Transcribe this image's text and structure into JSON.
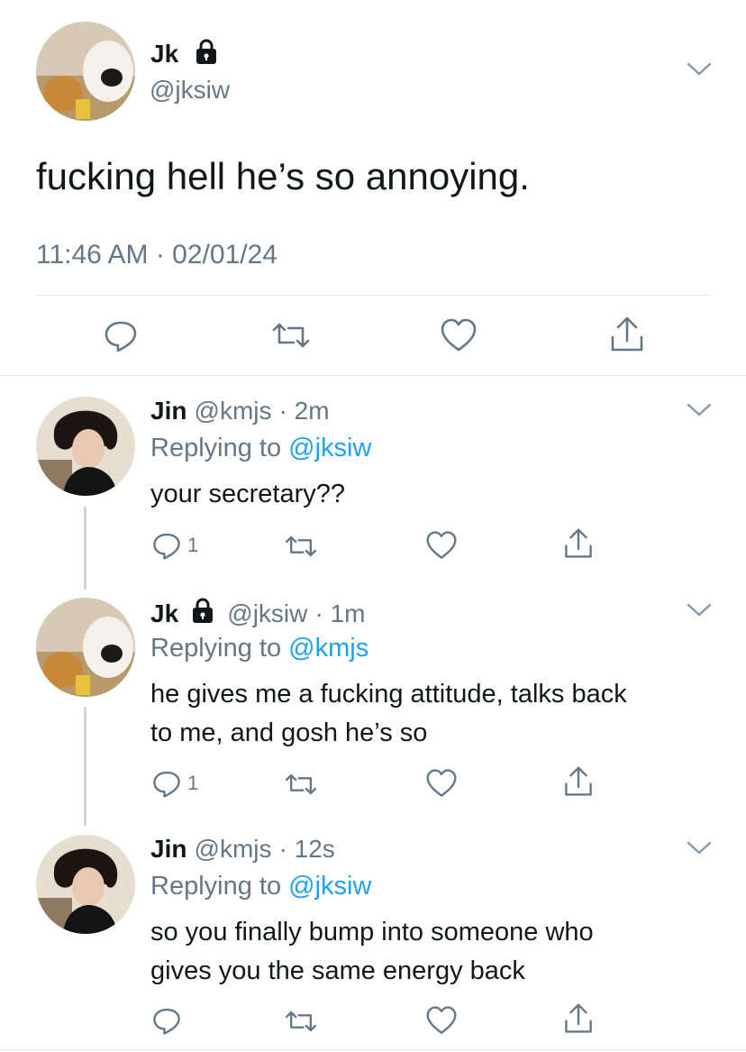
{
  "colors": {
    "link": "#1da1f2",
    "muted": "#657786",
    "text": "#14171a",
    "divider": "#e1e8ed"
  },
  "main_tweet": {
    "display_name": "Jk",
    "protected_icon": "lock-icon",
    "handle": "@jksiw",
    "text": "fucking hell he’s so annoying.",
    "timestamp": "11:46 AM · 02/01/24",
    "actions": [
      "reply-icon",
      "retweet-icon",
      "like-icon",
      "share-icon"
    ]
  },
  "replies": [
    {
      "display_name": "Jin",
      "handle": "@kmjs",
      "time": "· 2m",
      "replying_prefix": "Replying to ",
      "replying_to": "@jksiw",
      "text": "your secretary??",
      "reply_count": "1"
    },
    {
      "display_name": "Jk",
      "handle": "@jksiw",
      "time": "· 1m",
      "replying_prefix": "Replying to ",
      "replying_to": "@kmjs",
      "text_line1": "he gives me a fucking attitude, talks back",
      "text_line2": "to me, and gosh he’s so",
      "reply_count": "1"
    },
    {
      "display_name": "Jin",
      "handle": "@kmjs",
      "time": "· 12s",
      "replying_prefix": "Replying to ",
      "replying_to": "@jksiw",
      "text_line1": "so you finally bump into someone who",
      "text_line2": "gives you the same energy back",
      "reply_count": ""
    }
  ]
}
